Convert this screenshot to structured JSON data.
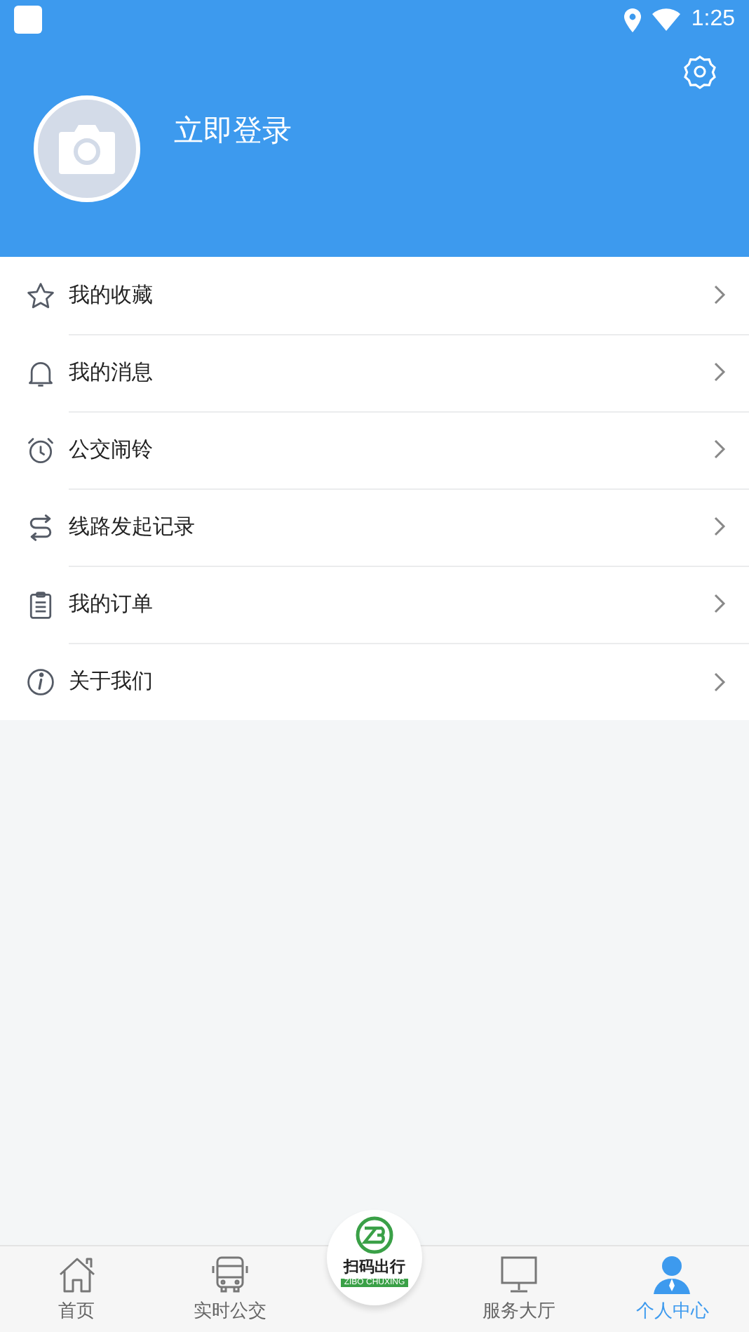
{
  "status_bar": {
    "time": "1:25"
  },
  "profile": {
    "login_label": "立即登录"
  },
  "menu": [
    {
      "label": "我的收藏"
    },
    {
      "label": "我的消息"
    },
    {
      "label": "公交闹铃"
    },
    {
      "label": "线路发起记录"
    },
    {
      "label": "我的订单"
    },
    {
      "label": "关于我们"
    }
  ],
  "bottom_nav": {
    "tabs": [
      {
        "label": "首页",
        "selected": false
      },
      {
        "label": "实时公交",
        "selected": false
      },
      {
        "label": "服务大厅",
        "selected": false
      },
      {
        "label": "个人中心",
        "selected": true
      }
    ],
    "scan_button": {
      "title": "扫码出行",
      "subtitle": "ZIBO CHUXING"
    }
  }
}
